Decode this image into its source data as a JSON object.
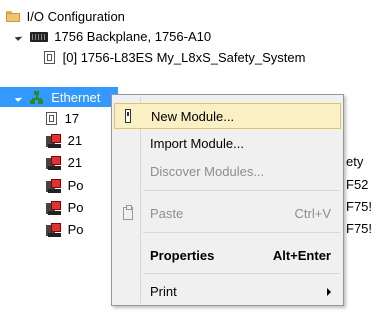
{
  "tree": {
    "root_label": "I/O Configuration",
    "backplane_label": "1756 Backplane, 1756-A10",
    "controller_label": "[0] 1756-L83ES My_L8xS_Safety_System",
    "ethernet_label": "Ethernet",
    "children": [
      {
        "label": "17",
        "icon": "controller-icon"
      },
      {
        "label": "21",
        "icon": "module-icon"
      },
      {
        "label": "21",
        "icon": "module-icon",
        "suffix": "ety"
      },
      {
        "label": "Po",
        "icon": "module-icon",
        "suffix": "F52"
      },
      {
        "label": "Po",
        "icon": "module-icon",
        "suffix": "F75!"
      },
      {
        "label": "Po",
        "icon": "module-icon",
        "suffix": "F75!"
      }
    ]
  },
  "context_menu": {
    "items": [
      {
        "label": "New Module...",
        "shortcut": "",
        "state": "highlighted",
        "icon": "new-module-icon"
      },
      {
        "label": "Import Module...",
        "shortcut": "",
        "state": "normal"
      },
      {
        "label": "Discover Modules...",
        "shortcut": "",
        "state": "disabled"
      },
      {
        "label": "Paste",
        "shortcut": "Ctrl+V",
        "state": "disabled",
        "icon": "paste-icon"
      },
      {
        "label": "Properties",
        "shortcut": "Alt+Enter",
        "state": "bold"
      },
      {
        "label": "Print",
        "shortcut": "",
        "state": "submenu"
      }
    ]
  },
  "colors": {
    "selection": "#3399ff",
    "menu_highlight": "#fbefc4",
    "menu_background": "#f0f0f0"
  }
}
